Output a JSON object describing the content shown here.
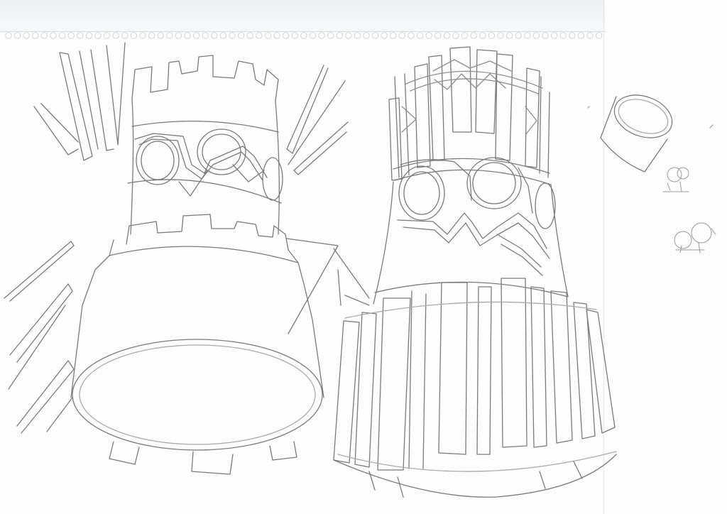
{
  "sketch": {
    "stroke_color": "#7a7a7a",
    "light_stroke_color": "#a9a9a9",
    "paper_color": "#fdfdfd",
    "edge_color": "#eef1f4",
    "perforation_color": "#cfd3d8"
  }
}
